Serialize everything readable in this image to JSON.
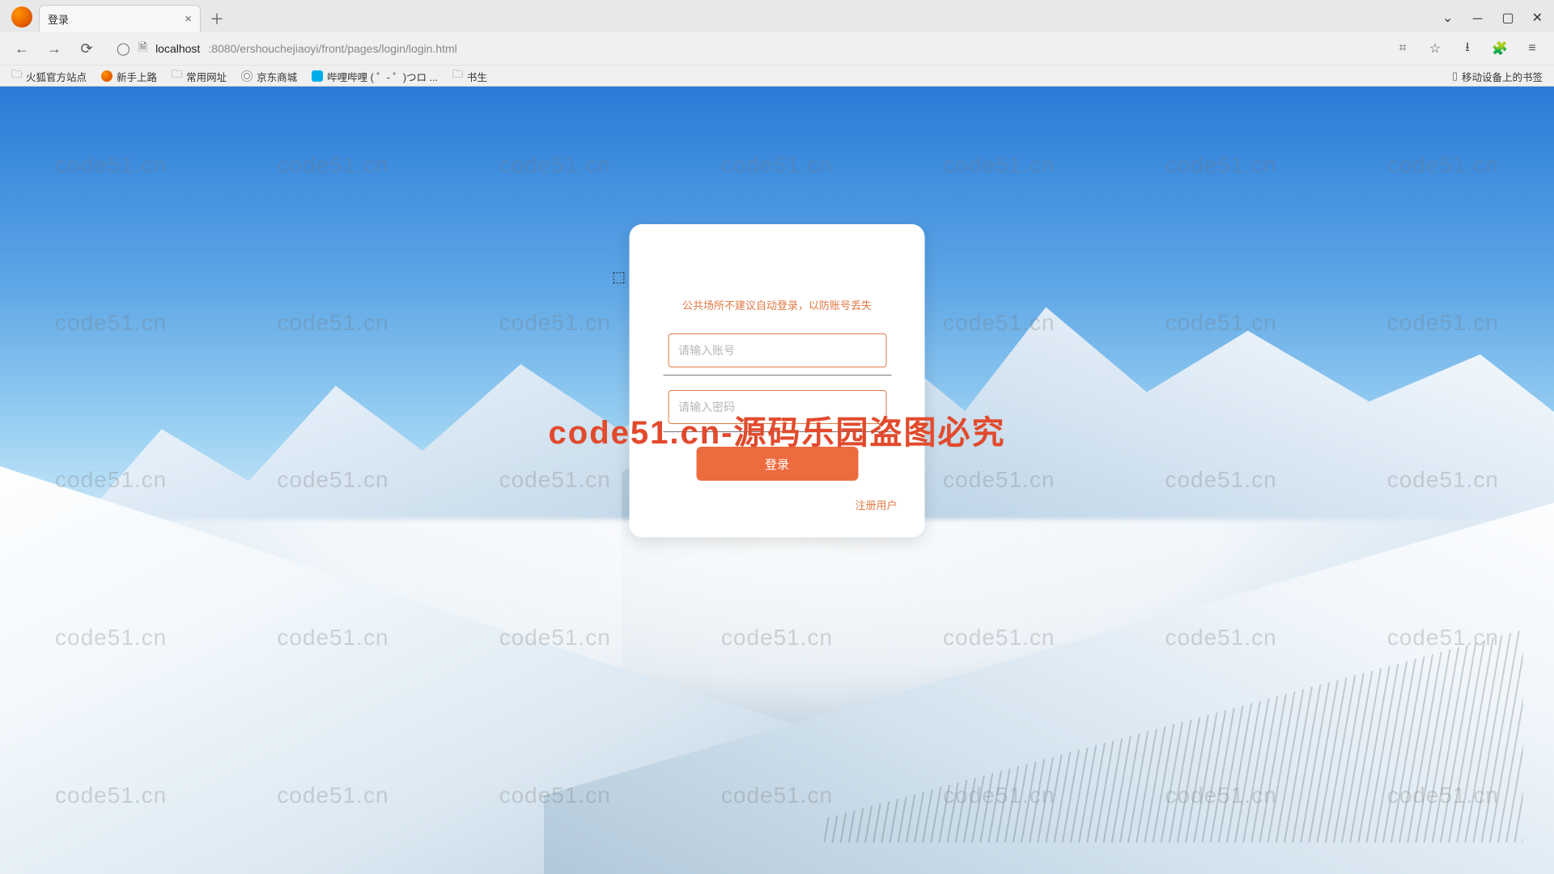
{
  "browser": {
    "tab_title": "登录",
    "url_host": "localhost",
    "url_port_path": ":8080/ershouchejiaoyi/front/pages/login/login.html",
    "bookmarks": {
      "b1": "火狐官方站点",
      "b2": "新手上路",
      "b3": "常用网址",
      "b4": "京东商城",
      "b5": "哔哩哔哩 ( ゜- ゜)つロ ...",
      "b6": "书生",
      "mobile": "移动设备上的书签"
    }
  },
  "watermark": {
    "cell": "code51.cn",
    "center": "code51.cn-源码乐园盗图必究"
  },
  "login": {
    "tip": "公共场所不建议自动登录，以防账号丢失",
    "ph_user": "请输入账号",
    "ph_pass": "请输入密码",
    "btn": "登录",
    "register": "注册用户"
  }
}
